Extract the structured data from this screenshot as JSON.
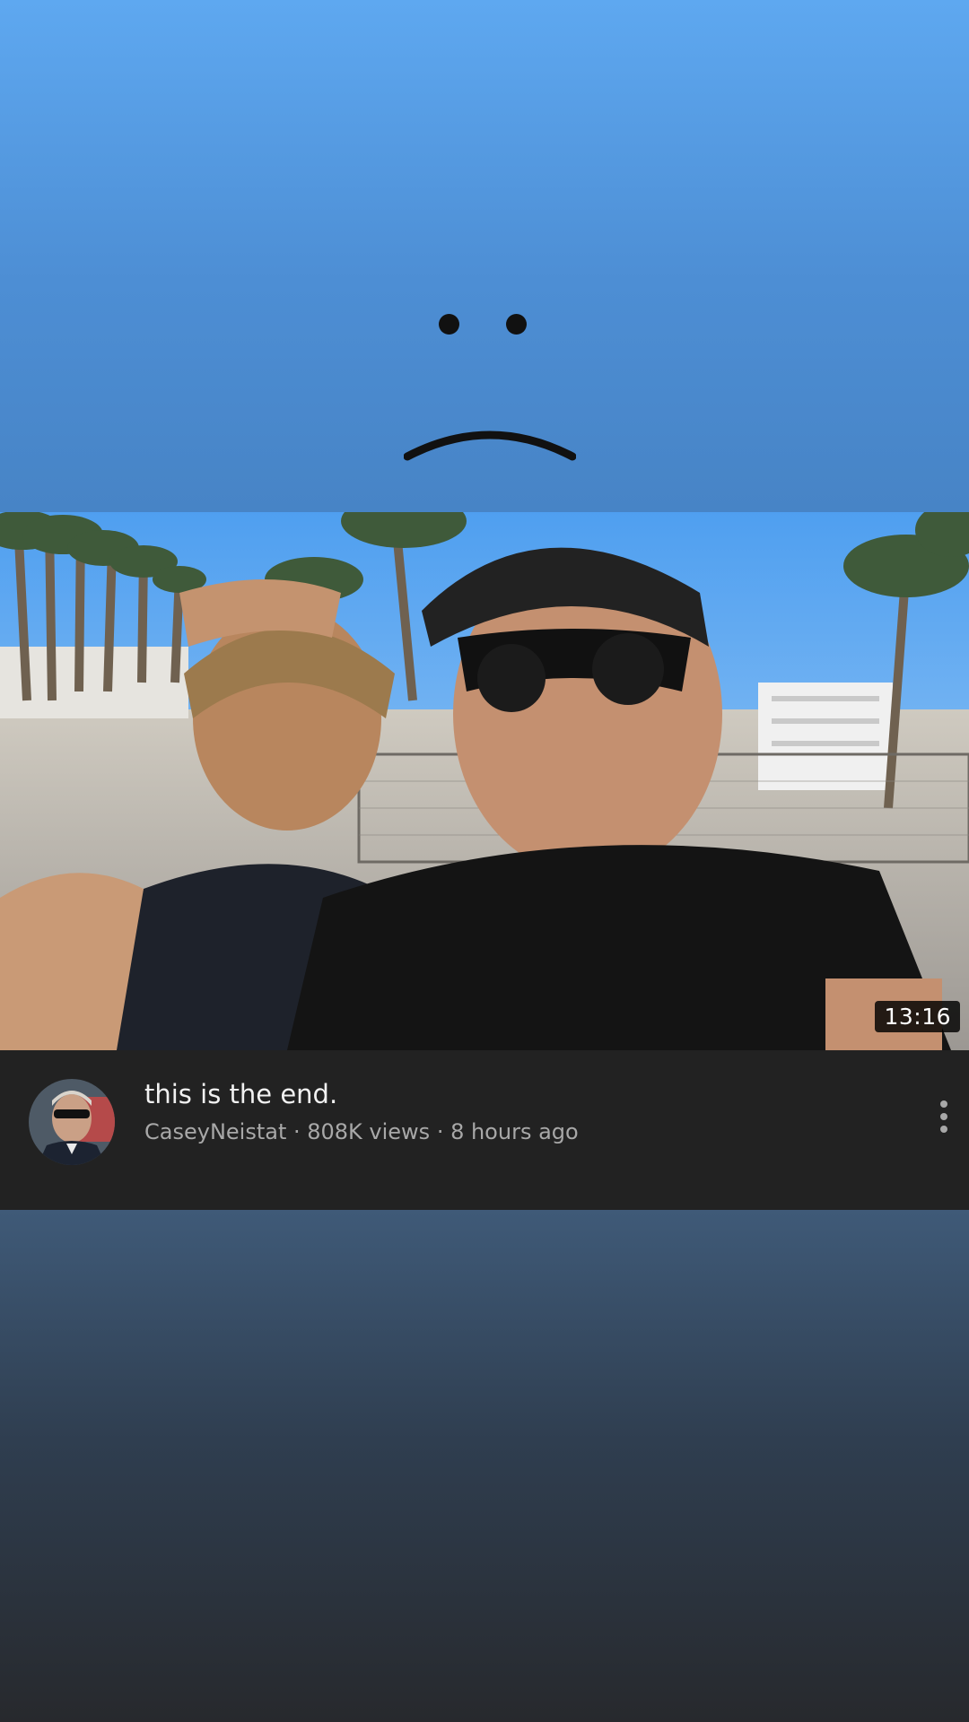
{
  "video": {
    "title": "this is the end.",
    "meta": "CaseyNeistat · 808K views · 8 hours ago",
    "duration": "13:16",
    "channel": "CaseyNeistat"
  },
  "icons": {
    "face": "sad-face-icon",
    "more": "more-vert-icon"
  },
  "colors": {
    "top_background": "#5ea8f0",
    "info_background": "#222222",
    "bottom_background": "#27292d"
  }
}
